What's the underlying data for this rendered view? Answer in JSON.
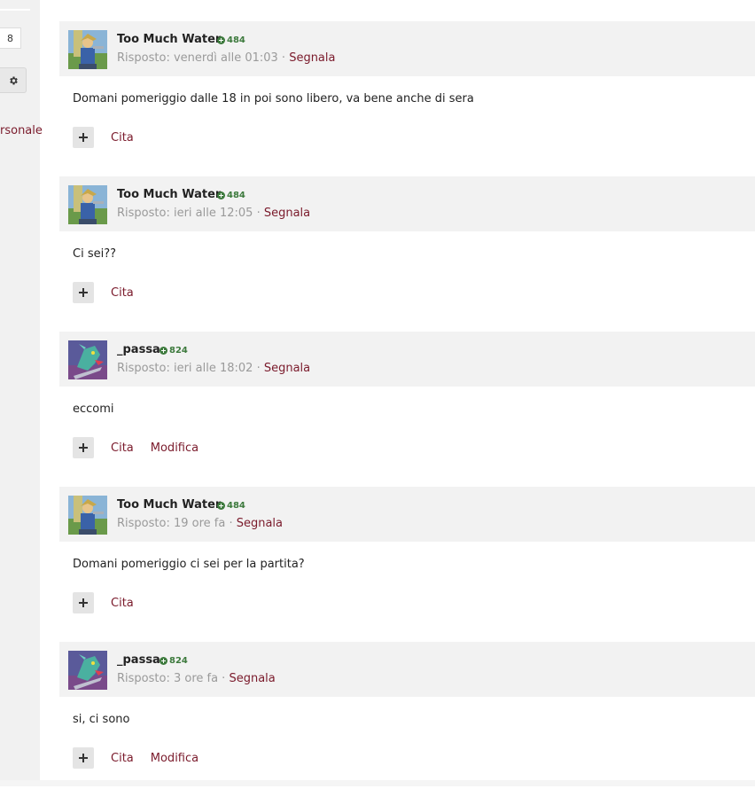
{
  "sidebar": {
    "count_badge": "8",
    "link_fragment": "rsonale"
  },
  "posts": [
    {
      "username": "Too Much Water.",
      "reputation": "484",
      "meta_prefix": "Risposto: venerdì alle 01:03 · ",
      "report_label": "Segnala",
      "content": "Domani pomeriggio dalle 18 in poi sono libero, va bene anche di sera",
      "quote_label": "Cita",
      "avatar": "link-avatar"
    },
    {
      "username": "Too Much Water.",
      "reputation": "484",
      "meta_prefix": "Risposto: ieri alle 12:05 · ",
      "report_label": "Segnala",
      "content": "Ci sei??",
      "quote_label": "Cita",
      "avatar": "link-avatar"
    },
    {
      "username": "_passa",
      "reputation": "824",
      "meta_prefix": "Risposto: ieri alle 18:02 · ",
      "report_label": "Segnala",
      "content": "eccomi",
      "quote_label": "Cita",
      "edit_label": "Modifica",
      "avatar": "dragon-avatar"
    },
    {
      "username": "Too Much Water.",
      "reputation": "484",
      "meta_prefix": "Risposto: 19 ore fa · ",
      "report_label": "Segnala",
      "content": "Domani pomeriggio ci sei per la partita?",
      "quote_label": "Cita",
      "avatar": "link-avatar"
    },
    {
      "username": "_passa",
      "reputation": "824",
      "meta_prefix": "Risposto: 3 ore fa · ",
      "report_label": "Segnala",
      "content": "si, ci sono",
      "quote_label": "Cita",
      "edit_label": "Modifica",
      "avatar": "dragon-avatar"
    }
  ],
  "colors": {
    "accent_link": "#7a1a2b",
    "reputation_green": "#3d7a3d",
    "header_bg": "#f2f2f2"
  }
}
